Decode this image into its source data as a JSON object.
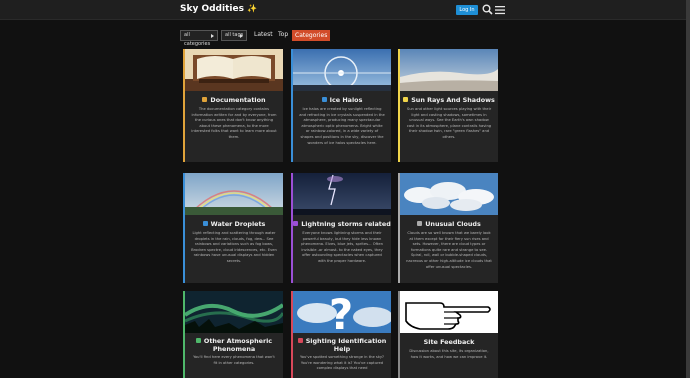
{
  "header": {
    "title": "Sky Oddities",
    "sparkle": "✨",
    "login_label": "Log In"
  },
  "nav": {
    "categories_dropdown": "all categories",
    "tags_dropdown": "all tags",
    "latest": "Latest",
    "top": "Top",
    "categories": "Categories"
  },
  "colors": {
    "accent": "#d24c2a",
    "login": "#1e8fd6",
    "documentation": "#e0a33a",
    "ice_halos": "#3a8fd8",
    "sun_rays": "#f0d44a",
    "water_droplets": "#3a8fd8",
    "lightning": "#9b4fd6",
    "unusual_clouds": "#aaaaaa",
    "other_phenomena": "#4fb86b",
    "sighting_help": "#d8485a",
    "site_feedback": "#888888"
  },
  "categories": [
    {
      "title": "Documentation",
      "icon": "book-icon",
      "description": "The documentation category contains information written for and by everyone, from the curious ones that don't know anything about these phenomena, to the more interested folks that want to learn more about them."
    },
    {
      "title": "Ice Halos",
      "icon": "snowflake-icon",
      "description": "Ice halos are created by sunlight reflecting and refracting in ice crystals suspended in the atmosphere, producing many spectacular atmospheric optic phenomena. Bright white or rainbow-colored, in a wide variety of shapes and positions in the sky, discover the wonders of ice halos spectacles here."
    },
    {
      "title": "Sun Rays And Shadows",
      "icon": "sun-icon",
      "description": "Sun and other light sources playing with their light and casting shadows, sometimes in unusual ways. See the Earth's own shadow cast in its atmosphere, plane contrails having their shadow twin, rare \"green flashes\" and others."
    },
    {
      "title": "Water Droplets",
      "icon": "droplet-icon",
      "description": "Light reflecting and scattering through water droplets in the rain, clouds, fog, dew... See rainbows and variations such as fog bows, Brocken spectre, cloud iridescences, etc. Even rainbows have unusual displays and hidden secrets."
    },
    {
      "title": "Lightning storms related",
      "icon": "lightning-icon",
      "description": "Everyone knows lightning storms and their powerful beauty, but they hide less known phenomena. Elves, blue jets, sprites... Often invisible -or almost- to the naked eyes, they offer astounding spectacles when captured with the proper hardware."
    },
    {
      "title": "Unusual Clouds",
      "icon": "cloud-icon",
      "description": "Clouds are so well known that we barely look at them except for their fiery sun rises and sets. However, there are cloud types or formations quite rare and strange to see. Spiral, roll, wall or bubble-shaped clouds, nacreous or other high-altitude ice clouds that offer unusual spectacles."
    },
    {
      "title": "Other Atmospheric Phenomena",
      "icon": "globe-icon",
      "description": "You'll find here every phenomena that won't fit in other categories."
    },
    {
      "title": "Sighting Identification Help",
      "icon": "question-icon",
      "description": "You've spotted something strange in the sky? You're wondering what it is? You've captured complex displays that need"
    },
    {
      "title": "Site Feedback",
      "icon": "",
      "description": "Discussion about this site, its organization, how it works, and how we can improve it."
    }
  ]
}
